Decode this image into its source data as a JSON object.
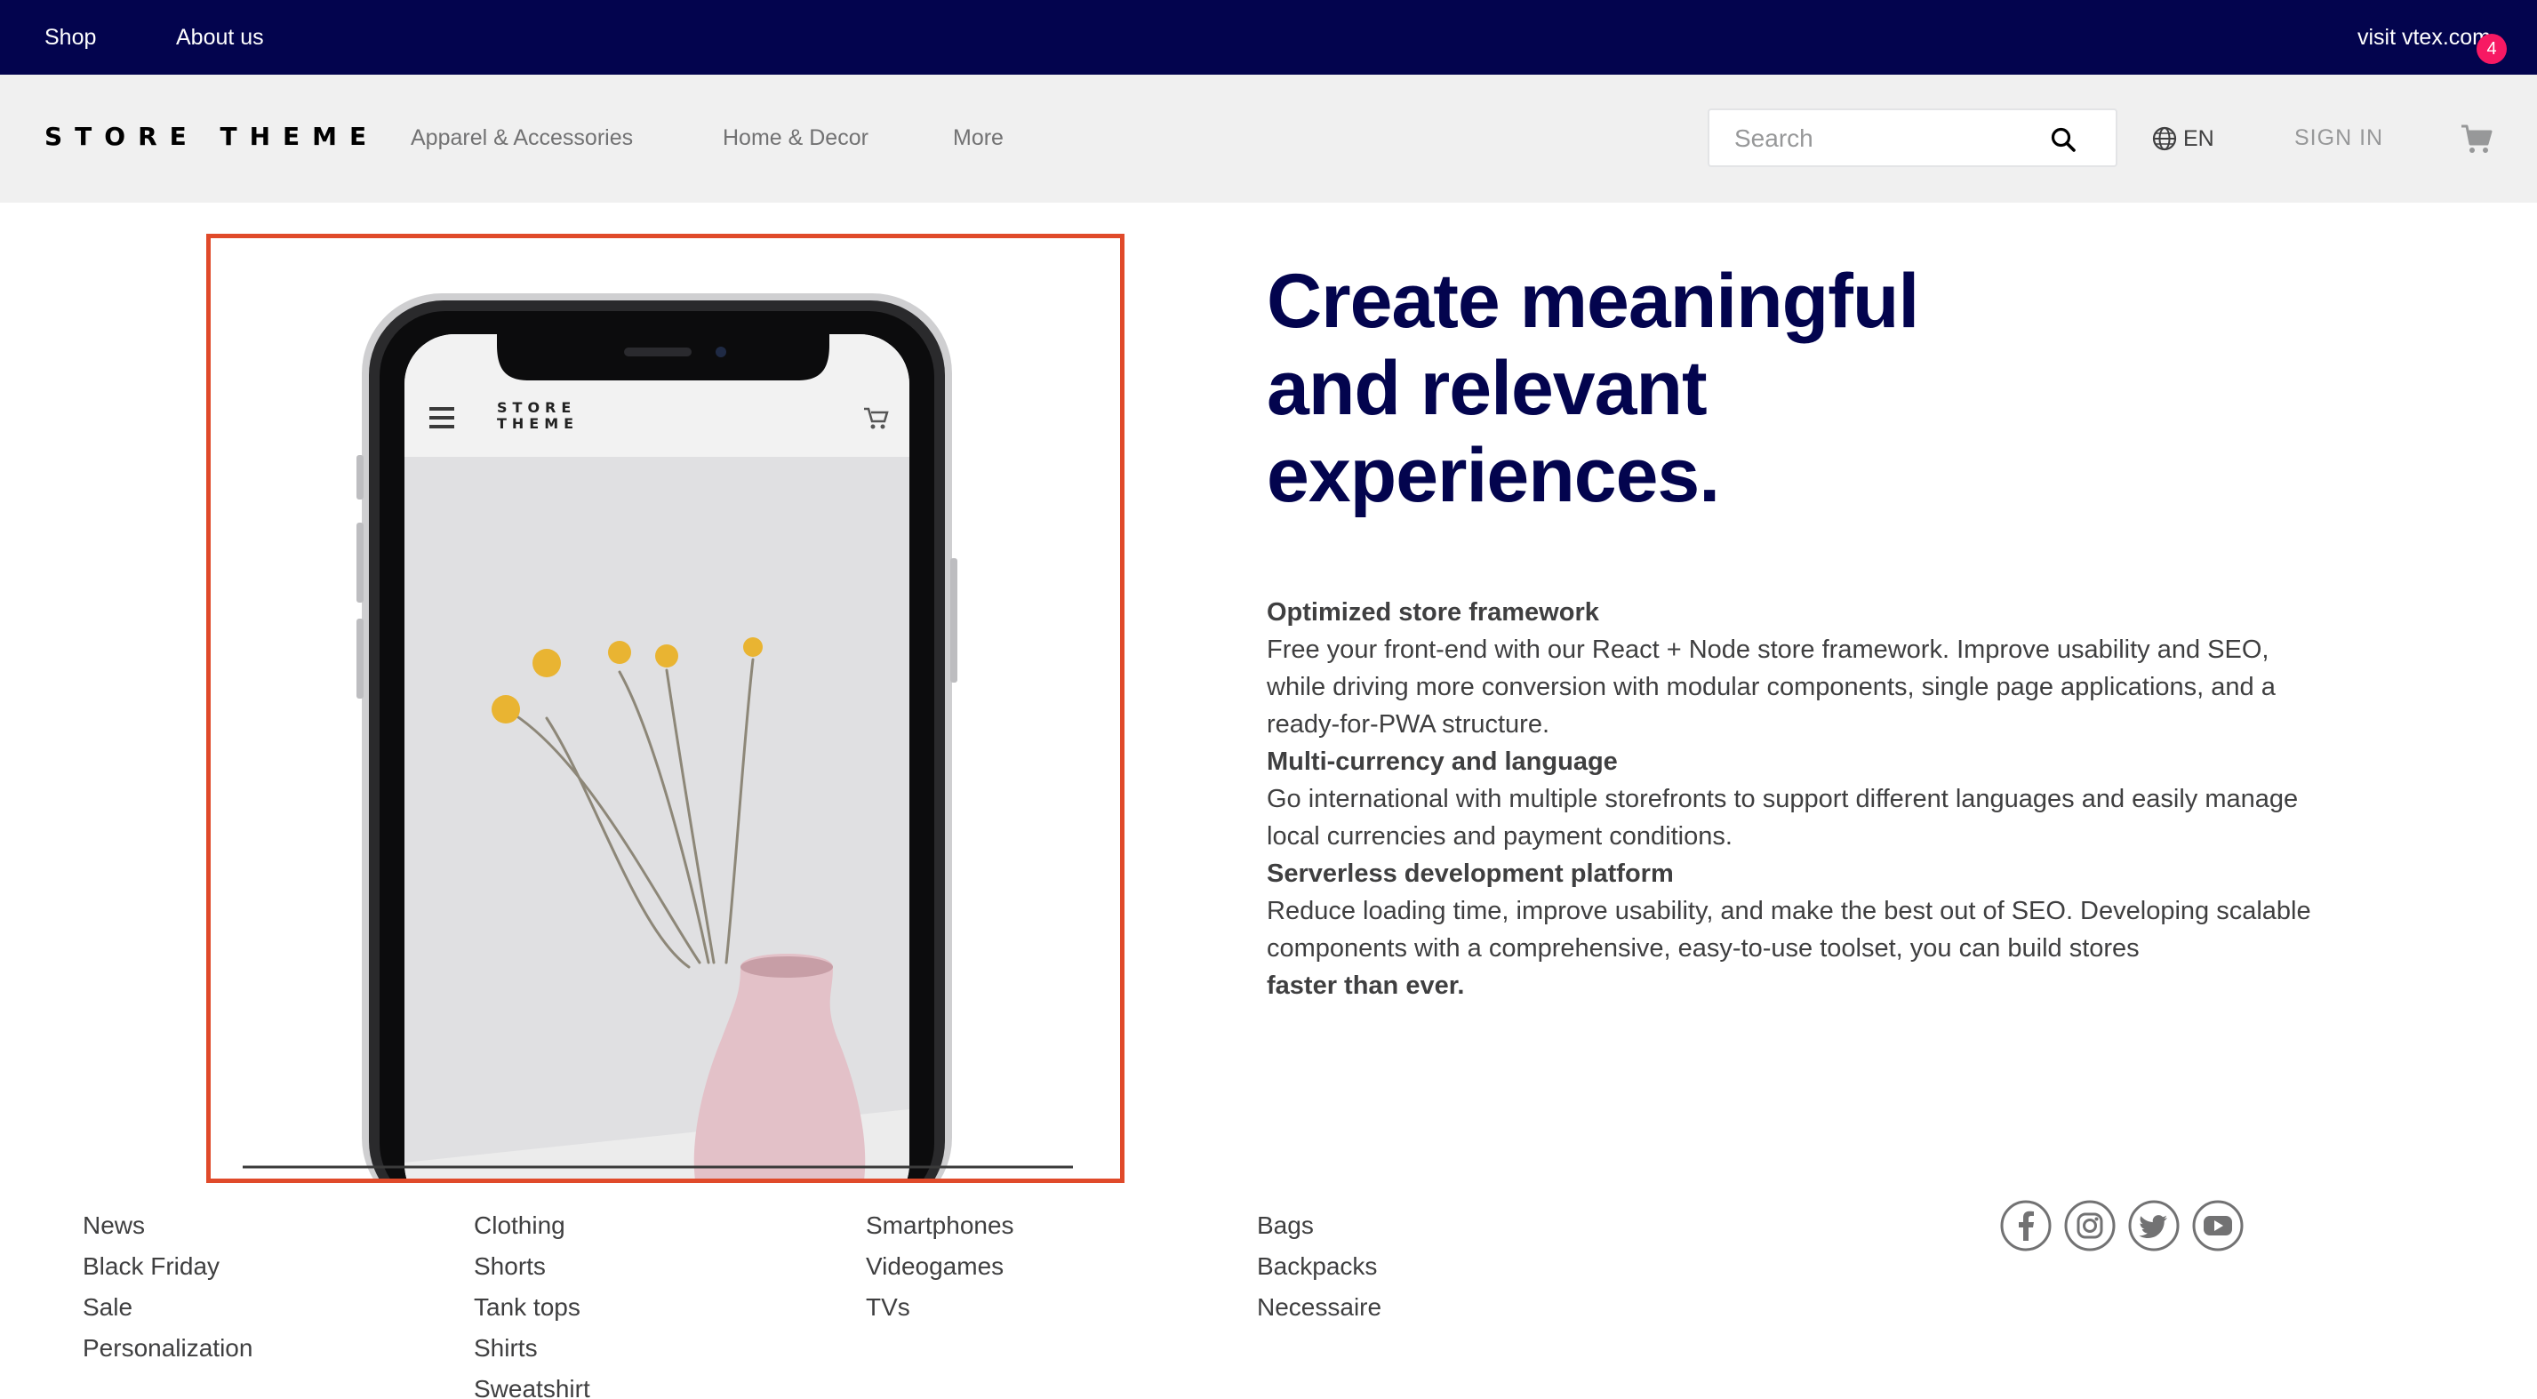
{
  "topbar": {
    "shop": "Shop",
    "about": "About us",
    "visit": "visit vtex.com"
  },
  "header": {
    "logo": "STORE THEME",
    "nav": [
      "Apparel & Accessories",
      "Home & Decor",
      "More"
    ],
    "search_placeholder": "Search",
    "language": "EN",
    "sign_in": "SIGN IN",
    "cart_count": "4"
  },
  "hero": {
    "phone_logo_line1": "STORE",
    "phone_logo_line2": "THEME",
    "headline": "Create meaningful and relevant experiences.",
    "features": [
      {
        "title": "Optimized store framework",
        "body": "Free your front-end with our React + Node store framework. Improve usability and SEO, while driving more conversion with modular components, single page applications, and a ready-for-PWA structure."
      },
      {
        "title": "Multi-currency and language",
        "body": "Go international with multiple storefronts to support different languages and easily manage local currencies and payment conditions."
      },
      {
        "title": "Serverless development platform",
        "body": "Reduce loading time, improve usability, and make the best out of SEO. Developing scalable components with a comprehensive, easy-to-use toolset, you can build stores",
        "body_bold": "faster than ever."
      }
    ]
  },
  "footer": {
    "col1": [
      "News",
      "Black Friday",
      "Sale",
      "Personalization"
    ],
    "col2": [
      "Clothing",
      "Shorts",
      "Tank tops",
      "Shirts",
      "Sweatshirt"
    ],
    "col3": [
      "Smartphones",
      "Videogames",
      "TVs"
    ],
    "col4": [
      "Bags",
      "Backpacks",
      "Necessaire"
    ],
    "social": [
      "facebook-icon",
      "instagram-icon",
      "twitter-icon",
      "youtube-icon"
    ]
  },
  "colors": {
    "topbar_bg": "#03044e",
    "header_bg": "#f0f0f0",
    "headline": "#03044e",
    "highlight_border": "#e04a2a",
    "cart_badge": "#f71963"
  }
}
